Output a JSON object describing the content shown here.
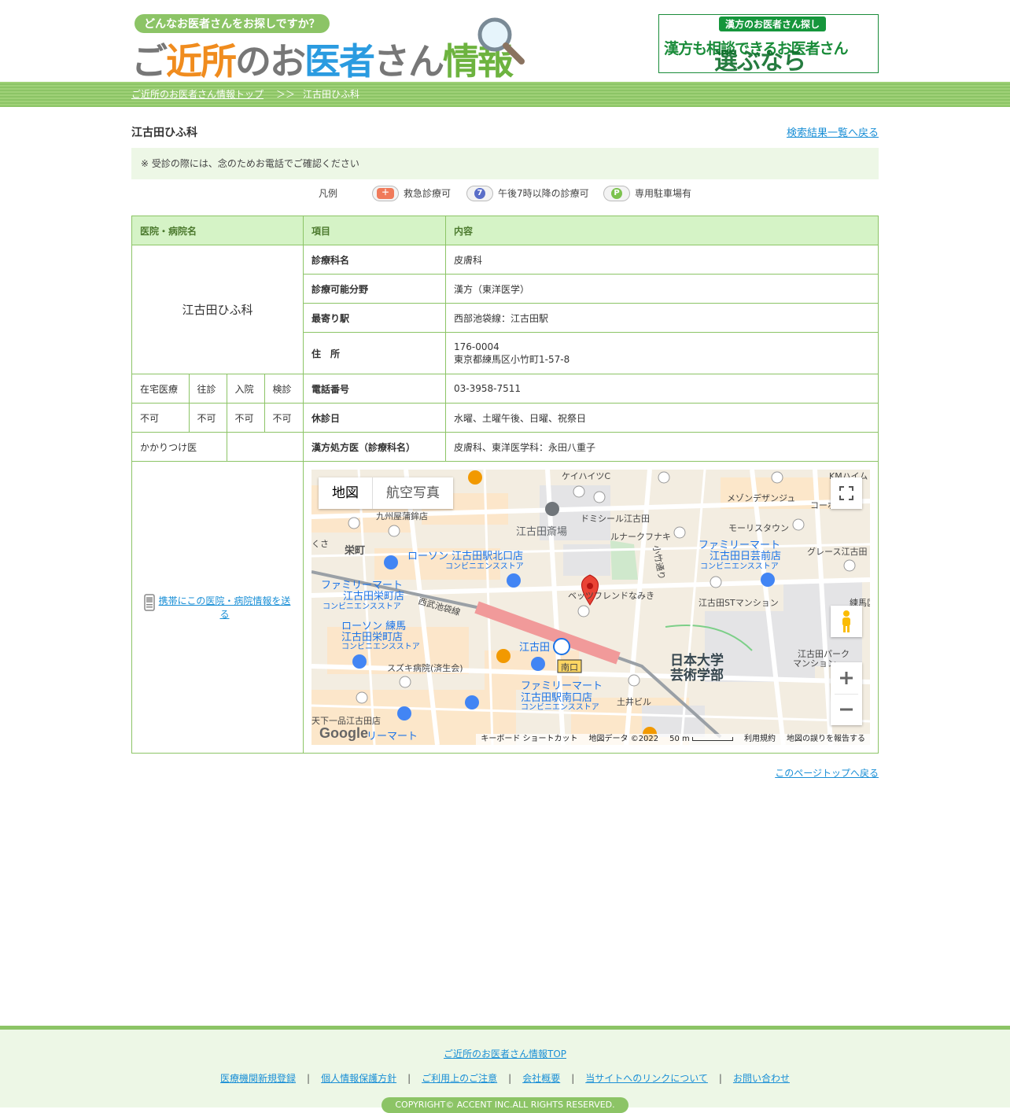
{
  "header": {
    "tagline": "どんなお医者さんをお探しですか？",
    "site_title_parts": [
      "ご",
      "近所",
      "のお",
      "医者",
      "さん",
      "情報"
    ],
    "banner": {
      "top": "漢方のお医者さん探し",
      "line1": "漢方も相談できるお医者さん",
      "line2": "選ぶなら"
    }
  },
  "breadcrumb": {
    "home": "ご近所のお医者さん情報トップ",
    "separator": "＞＞",
    "current": "江古田ひふ科"
  },
  "page": {
    "title": "江古田ひふ科",
    "back_link": "検索結果一覧へ戻る",
    "notice": "※ 受診の際には、念のためお電話でご確認ください"
  },
  "legend": {
    "label": "凡例",
    "items": [
      {
        "label": "救急診療可",
        "icon": "ambulance-icon",
        "color": "#f07a5a"
      },
      {
        "label": "午後7時以降の診療可",
        "icon": "clock-7-icon",
        "color": "#5a6ec8"
      },
      {
        "label": "専用駐車場有",
        "icon": "parking-icon",
        "color": "#7cc24e"
      }
    ]
  },
  "table": {
    "headers": [
      "医院・病院名",
      "項目",
      "内容"
    ],
    "hospital_name": "江古田ひふ科",
    "rows": [
      {
        "key": "診療科名",
        "value": "皮膚科"
      },
      {
        "key": "診療可能分野",
        "value": "漢方（東洋医学）"
      },
      {
        "key": "最寄り駅",
        "value": "西部池袋線：江古田駅"
      },
      {
        "key": "住　所",
        "postal": "176-0004",
        "value": "東京都練馬区小竹町1-57-8"
      },
      {
        "key": "電話番号",
        "value": "03-3958-7511"
      },
      {
        "key": "休診日",
        "value": "水曜、土曜午後、日曜、祝祭日"
      },
      {
        "key": "漢方処方医（診療科名）",
        "value": "皮膚科、東洋医学科：永田八重子"
      }
    ],
    "services": {
      "labels": [
        "在宅医療",
        "往診",
        "入院",
        "検診"
      ],
      "values": [
        "不可",
        "不可",
        "不可",
        "不可"
      ]
    },
    "kakaritsuke": {
      "label": "かかりつけ医",
      "value": ""
    },
    "mobile_link": "携帯にこの医院・病院情報を送る"
  },
  "map": {
    "tabs": [
      "地図",
      "航空写真"
    ],
    "labels": {
      "keihaitsu": "ケイハイツC",
      "kmhaim": "KMハイム",
      "maison": "メゾンデザンジュ",
      "kyushu": "九州屋蒲鉾店",
      "ekoda_saijo": "江古田斎場",
      "domicile": "ドミシール江古田",
      "morris": "モーリスタウン",
      "co": "コーポ",
      "lunark": "ルナークフナキ",
      "grace": "グレース江古田",
      "sakaecho": "栄町",
      "lawson1": "ローソン 江古田駅北口店",
      "conv": "コンビニエンスストア",
      "fm_geijutsu1": "ファミリーマート",
      "fm_geijutsu2": "江古田日芸前店",
      "fm_sakae1": "ファミリーマート",
      "fm_sakae2": "江古田栄町店",
      "kotake": "小竹通り",
      "seibu": "西武池袋線",
      "friend": "ベッツフレンドなみき",
      "st": "江古田STマンション",
      "nerima": "練馬区",
      "lawson_n1": "ローソン 練馬",
      "lawson_n2": "江古田栄町店",
      "ekoda": "江古田",
      "minami": "南口",
      "nichidai1": "日本大学",
      "nichidai2": "芸術学部",
      "park1": "江古田パーク",
      "park2": "マンション",
      "suzuki": "スズキ病院(済生会)",
      "fm_minami1": "ファミリーマート",
      "fm_minami2": "江古田駅南口店",
      "tsuchii": "土井ビル",
      "tenka": "天下一品江古田店",
      "fm_bottom": "リーマート",
      "kusa": "くさ"
    },
    "google": "Google",
    "footer": [
      "キーボード ショートカット",
      "地図データ ©2022",
      "50 m",
      "利用規約",
      "地図の誤りを報告する"
    ]
  },
  "pagetop": "このページトップへ戻る",
  "footer": {
    "top_link": "ご近所のお医者さん情報TOP",
    "links": [
      "医療機関新規登録",
      "個人情報保護方針",
      "ご利用上のご注意",
      "会社概要",
      "当サイトへのリンクについて",
      "お問い合わせ"
    ],
    "separator": "|",
    "copyright": "COPYRIGHT© ACCENT INC.ALL RIGHTS RESERVED."
  }
}
